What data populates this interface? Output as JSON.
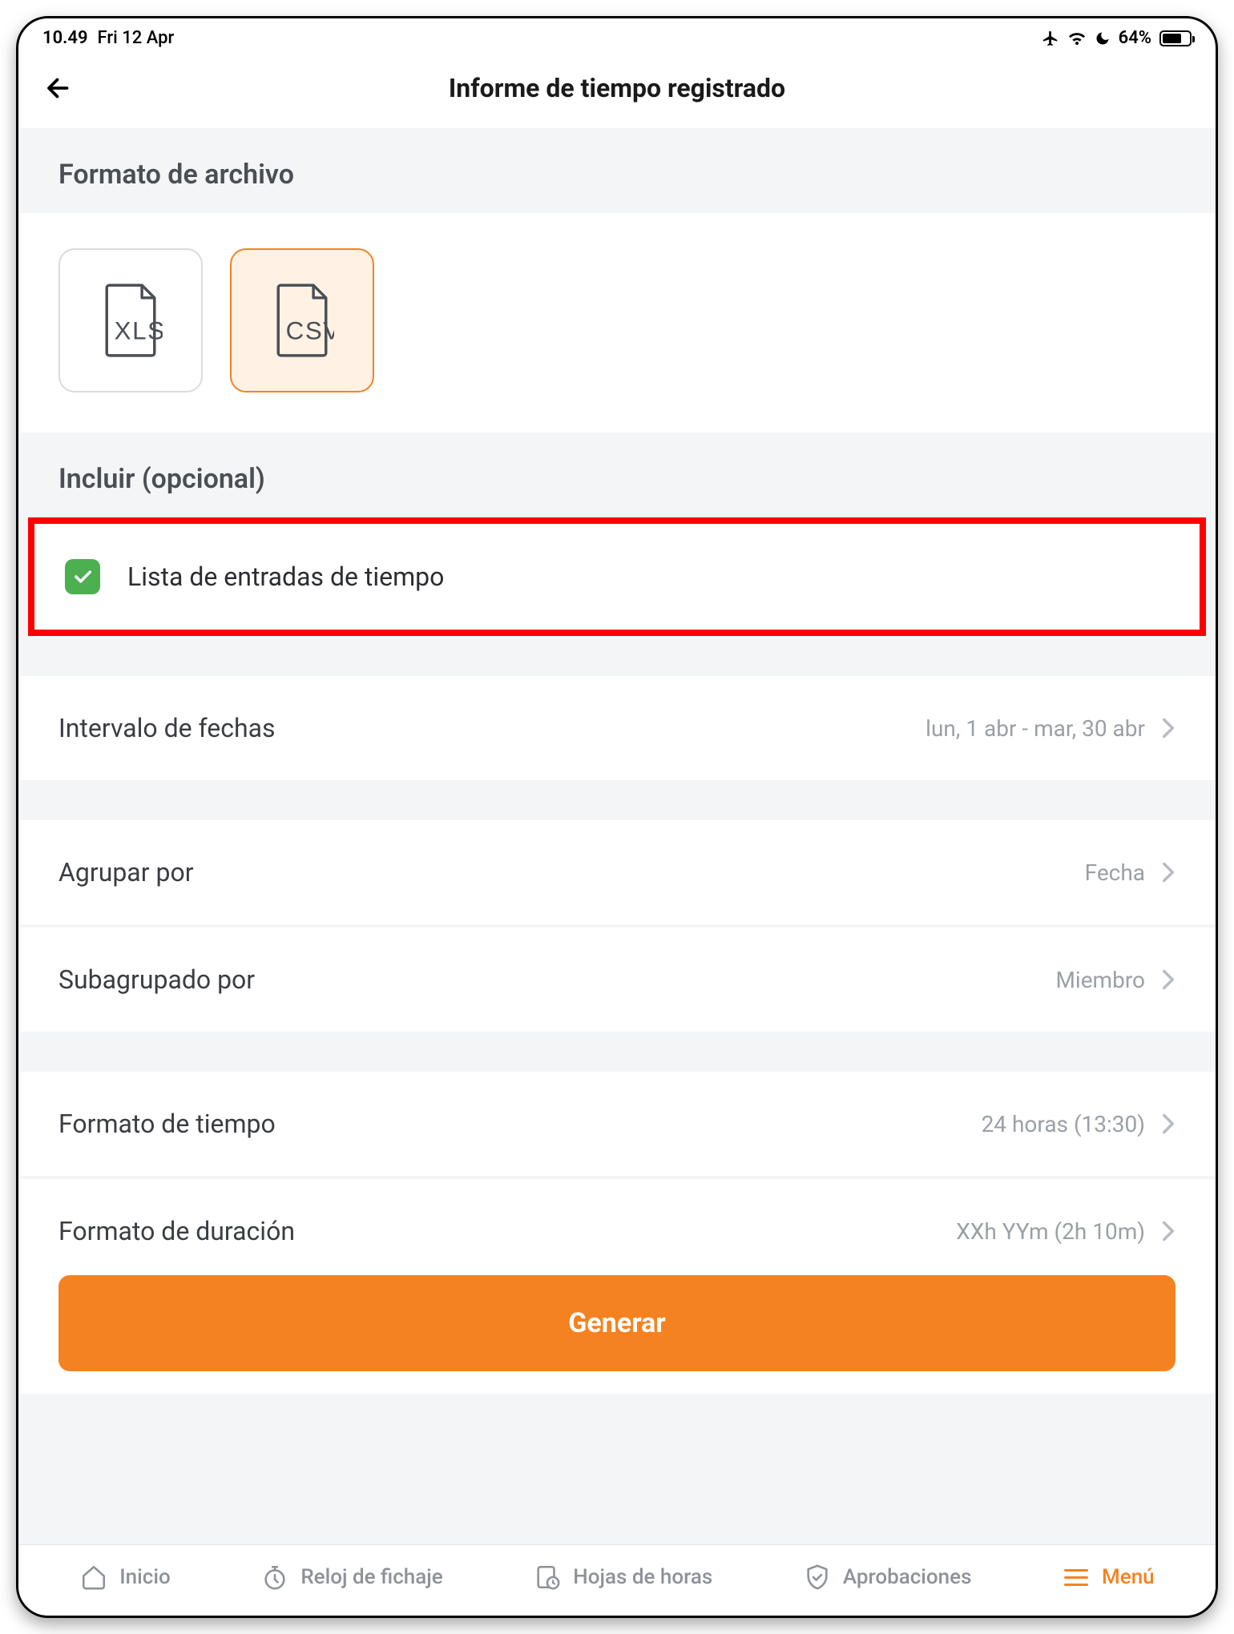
{
  "status_bar": {
    "time": "10.49",
    "date": "Fri 12 Apr",
    "battery_percent": "64%"
  },
  "header": {
    "title": "Informe de tiempo registrado"
  },
  "sections": {
    "file_format_header": "Formato de archivo",
    "include_header": "Incluir (opcional)"
  },
  "file_formats": {
    "xls_label": "XLS",
    "csv_label": "CSV"
  },
  "include_option": {
    "label": "Lista de entradas de tiempo"
  },
  "settings": {
    "date_range": {
      "label": "Intervalo de fechas",
      "value": "lun, 1 abr - mar, 30 abr"
    },
    "group_by": {
      "label": "Agrupar por",
      "value": "Fecha"
    },
    "subgroup_by": {
      "label": "Subagrupado por",
      "value": "Miembro"
    },
    "time_format": {
      "label": "Formato de tiempo",
      "value": "24 horas (13:30)"
    },
    "duration_format": {
      "label": "Formato de duración",
      "value": "XXh YYm (2h 10m)"
    }
  },
  "actions": {
    "generate": "Generar"
  },
  "tabs": {
    "home": "Inicio",
    "clock": "Reloj de fichaje",
    "timesheets": "Hojas de horas",
    "approvals": "Aprobaciones",
    "menu": "Menú"
  }
}
